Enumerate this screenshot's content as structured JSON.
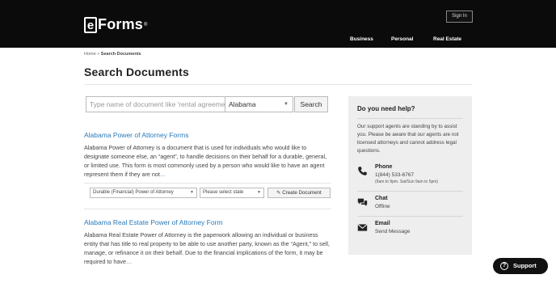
{
  "header": {
    "logo_letter": "e",
    "logo_text": "Forms",
    "logo_mark": "®",
    "signin_label": "Sign In",
    "nav": [
      "Business",
      "Personal",
      "Real Estate"
    ]
  },
  "breadcrumb": {
    "home": "Home",
    "separator": " » ",
    "current": "Search Documents"
  },
  "page_title": "Search Documents",
  "search": {
    "placeholder": "Type name of document like 'rental agreement'",
    "state_value": "Alabama",
    "button_label": "Search"
  },
  "results": [
    {
      "title": "Alabama Power of Attorney Forms",
      "description": "Alabama Power of Attorney is a document that is used for individuals who would like to designate someone else, an “agent”, to handle decisions on their behalf for a durable, general, or limited use. This form is most commonly used by a person who would like to have an agent represent them if they are not",
      "more": "…",
      "type_select": "Durable (Financial) Power of Attorney",
      "state_select": "Please select state",
      "create_label": "Create Document"
    },
    {
      "title": "Alabama Real Estate Power of Attorney Form",
      "description": "Alabama Real Estate Power of Attorney is the paperwork allowing an individual or business entity that has title to real property to be able to use another party, known as the “Agent,” to sell, manage, or refinance it on their behalf. Due to the financial implications of the form, it may be required to have",
      "more": "…"
    }
  ],
  "help": {
    "title": "Do you need help?",
    "text": "Our support agents are standing by to assist you. Please be aware that our agents are not licensed attorneys and cannot address legal questions.",
    "phone": {
      "label": "Phone",
      "value": "1(844) 533-6767",
      "hours": "(9am to 9pm. Sat/Sun 9am to 5pm)"
    },
    "chat": {
      "label": "Chat",
      "value": "Offline"
    },
    "email": {
      "label": "Email",
      "value": "Send Message"
    }
  },
  "support_label": "Support",
  "colors": {
    "header_bg": "#0b0b0b",
    "link": "#2a7ab9",
    "panel_bg": "#eeeeee"
  }
}
